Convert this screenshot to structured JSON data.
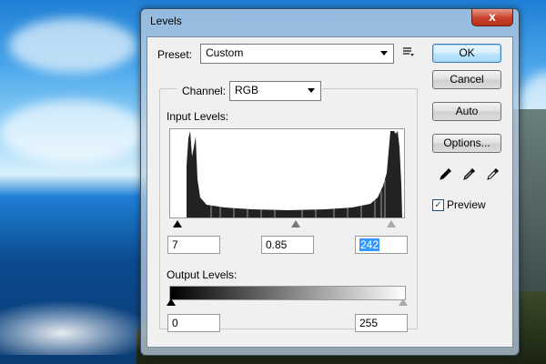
{
  "window": {
    "title": "Levels",
    "close_label": "x"
  },
  "preset": {
    "label": "Preset:",
    "value": "Custom"
  },
  "channel": {
    "label": "Channel:",
    "value": "RGB"
  },
  "input_levels": {
    "label": "Input Levels:",
    "black": "7",
    "gamma": "0.85",
    "white": "242"
  },
  "output_levels": {
    "label": "Output Levels:",
    "black": "0",
    "white": "255"
  },
  "buttons": {
    "ok": "OK",
    "cancel": "Cancel",
    "auto": "Auto",
    "options": "Options..."
  },
  "preview": {
    "label": "Preview",
    "checked": true
  },
  "icons": [
    "close-icon",
    "preset-menu-icon",
    "dropdown-arrow-icon",
    "black-eyedropper-icon",
    "gray-eyedropper-icon",
    "white-eyedropper-icon",
    "checkmark-icon"
  ]
}
